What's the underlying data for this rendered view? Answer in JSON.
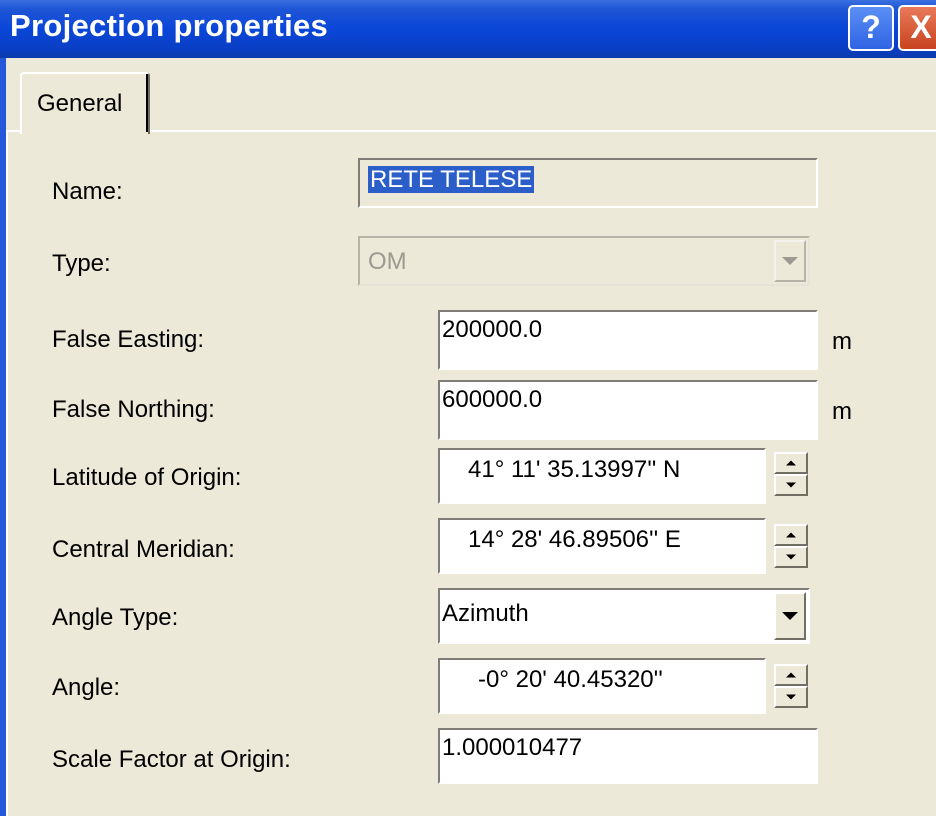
{
  "window": {
    "title": "Projection properties",
    "help_label": "?",
    "close_label": "X"
  },
  "tabs": [
    {
      "label": "General"
    }
  ],
  "form": {
    "name": {
      "label": "Name:",
      "value": "RETE TELESE"
    },
    "type": {
      "label": "Type:",
      "value": "OM"
    },
    "false_easting": {
      "label": "False Easting:",
      "value": "200000.0",
      "unit": "m"
    },
    "false_northing": {
      "label": "False Northing:",
      "value": "600000.0",
      "unit": "m"
    },
    "latitude_origin": {
      "label": "Latitude of Origin:",
      "value": "41° 11' 35.13997'' N"
    },
    "central_meridian": {
      "label": "Central Meridian:",
      "value": "14° 28' 46.89506'' E"
    },
    "angle_type": {
      "label": "Angle Type:",
      "value": "Azimuth"
    },
    "angle": {
      "label": "Angle:",
      "value": "-0° 20' 40.45320''"
    },
    "scale_factor": {
      "label": "Scale Factor at Origin:",
      "value": "1.000010477"
    }
  }
}
